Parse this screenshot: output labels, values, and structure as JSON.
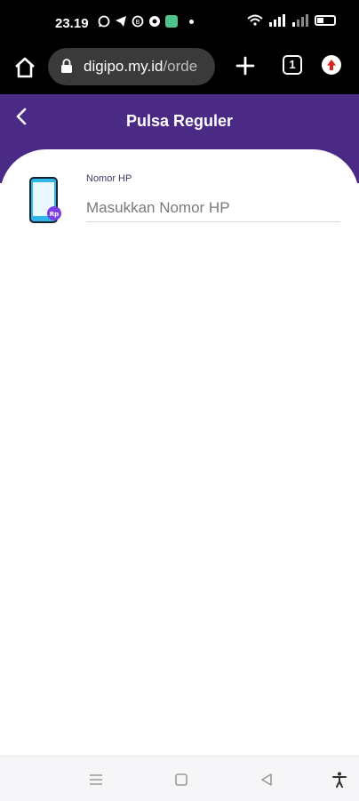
{
  "status_bar": {
    "time": "23.19",
    "left_icons": [
      "whatsapp-icon",
      "telegram-icon",
      "whatsapp-business-icon",
      "app-icon",
      "green-app-icon",
      "dot-icon"
    ],
    "right_icons": [
      "wifi-icon",
      "signal-icon",
      "signal-icon",
      "battery-icon"
    ]
  },
  "browser": {
    "domain": "digipo.my.id",
    "path": "/orde",
    "tab_count": "1"
  },
  "header": {
    "title": "Pulsa Reguler",
    "back_icon": "chevron-left-icon"
  },
  "form": {
    "label": "Nomor HP",
    "placeholder": "Masukkan Nomor HP",
    "value": "",
    "phone_badge": "Rp"
  },
  "nav": {
    "items": [
      "menu-icon",
      "home-square-icon",
      "back-triangle-icon",
      "accessibility-icon"
    ]
  },
  "colors": {
    "accent": "#4b2a85",
    "badge": "#7b3fe4",
    "phone_screen": "#2fb6e8"
  }
}
